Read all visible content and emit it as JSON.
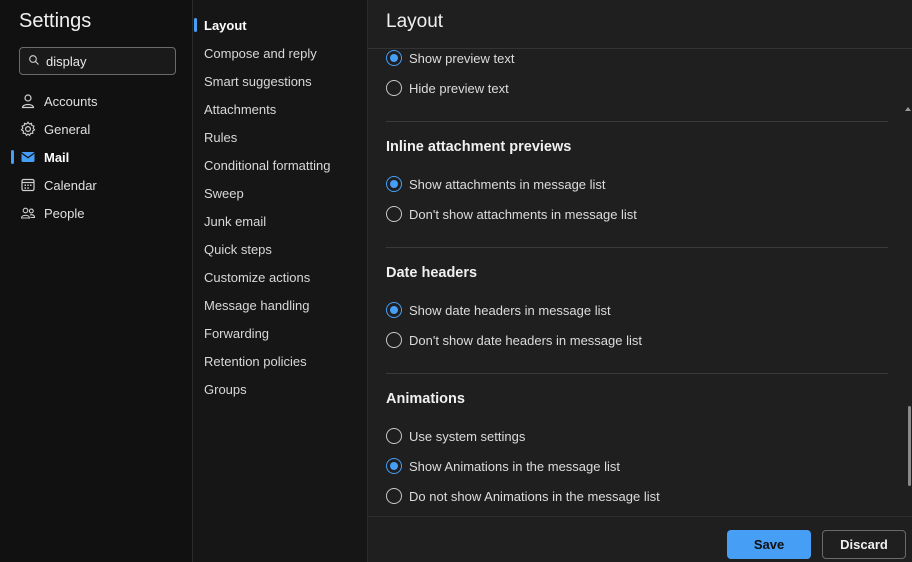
{
  "app": {
    "title": "Settings"
  },
  "search": {
    "value": "display"
  },
  "sidebar": {
    "items": [
      {
        "label": "Accounts",
        "icon": "person-icon",
        "active": false
      },
      {
        "label": "General",
        "icon": "gear-icon",
        "active": false
      },
      {
        "label": "Mail",
        "icon": "mail-icon",
        "active": true
      },
      {
        "label": "Calendar",
        "icon": "calendar-icon",
        "active": false
      },
      {
        "label": "People",
        "icon": "people-icon",
        "active": false
      }
    ]
  },
  "subnav": {
    "items": [
      {
        "label": "Layout",
        "active": true
      },
      {
        "label": "Compose and reply"
      },
      {
        "label": "Smart suggestions"
      },
      {
        "label": "Attachments"
      },
      {
        "label": "Rules"
      },
      {
        "label": "Conditional formatting"
      },
      {
        "label": "Sweep"
      },
      {
        "label": "Junk email"
      },
      {
        "label": "Quick steps"
      },
      {
        "label": "Customize actions"
      },
      {
        "label": "Message handling"
      },
      {
        "label": "Forwarding"
      },
      {
        "label": "Retention policies"
      },
      {
        "label": "Groups"
      }
    ]
  },
  "main": {
    "title": "Layout",
    "preview": {
      "options": [
        {
          "label": "Show preview text",
          "checked": true
        },
        {
          "label": "Hide preview text",
          "checked": false
        }
      ]
    },
    "inline_attachments": {
      "title": "Inline attachment previews",
      "options": [
        {
          "label": "Show attachments in message list",
          "checked": true
        },
        {
          "label": "Don't show attachments in message list",
          "checked": false
        }
      ]
    },
    "date_headers": {
      "title": "Date headers",
      "options": [
        {
          "label": "Show date headers in message list",
          "checked": true
        },
        {
          "label": "Don't show date headers in message list",
          "checked": false
        }
      ]
    },
    "animations": {
      "title": "Animations",
      "options": [
        {
          "label": "Use system settings",
          "checked": false
        },
        {
          "label": "Show Animations in the message list",
          "checked": true
        },
        {
          "label": "Do not show Animations in the message list",
          "checked": false
        }
      ]
    }
  },
  "footer": {
    "save_label": "Save",
    "discard_label": "Discard"
  },
  "colors": {
    "accent": "#479ef5",
    "background": "#1f1f1f",
    "sidebar": "#111111"
  }
}
